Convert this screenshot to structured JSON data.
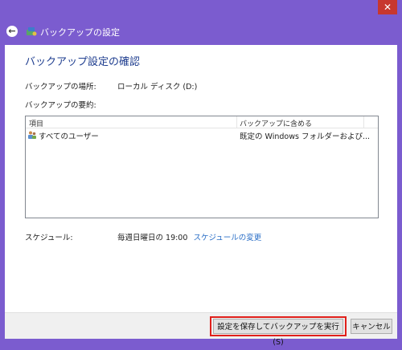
{
  "window": {
    "close_glyph": "✕"
  },
  "nav": {
    "title": "バックアップの設定",
    "back_glyph": "←"
  },
  "page": {
    "title": "バックアップ設定の確認"
  },
  "location": {
    "label": "バックアップの場所:",
    "value": "ローカル ディスク (D:)"
  },
  "summary": {
    "label": "バックアップの要約:",
    "columns": [
      "項目",
      "バックアップに含める"
    ],
    "rows": [
      {
        "item": "すべてのユーザー",
        "included": "既定の Windows フォルダーおよび..."
      }
    ]
  },
  "schedule": {
    "label": "スケジュール:",
    "value": "毎週日曜日の 19:00",
    "link": "スケジュールの変更"
  },
  "footer": {
    "save_run_label": "設定を保存してバックアップを実行(S)",
    "cancel_label": "キャンセル"
  },
  "colors": {
    "accent": "#7b5ccf",
    "title": "#1e3d8f",
    "link": "#2b6fc7",
    "highlight": "#e0201b"
  }
}
